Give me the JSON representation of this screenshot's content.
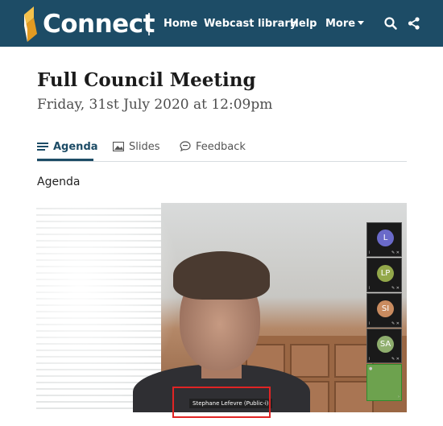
{
  "header": {
    "brand": "Connect",
    "nav": [
      "Home",
      "Webcast library",
      "Help",
      "More"
    ],
    "icons": [
      "search-icon",
      "share-icon"
    ],
    "colors": {
      "bar": "#1d4c66",
      "logo_light": "#f4c14b",
      "logo_dark": "#e29b22"
    }
  },
  "meeting": {
    "title": "Full Council Meeting",
    "date": "Friday, 31st July 2020 at 12:09pm"
  },
  "tabs": [
    {
      "label": "Agenda",
      "icon": "list-icon",
      "active": true
    },
    {
      "label": "Slides",
      "icon": "image-icon",
      "active": false
    },
    {
      "label": "Feedback",
      "icon": "chat-bubble-icon",
      "active": false
    }
  ],
  "section_title": "Agenda",
  "video": {
    "participants": [
      {
        "initials": "L",
        "color": "#6a6ac9"
      },
      {
        "initials": "LP",
        "color": "#93a84a"
      },
      {
        "initials": "SI",
        "color": "#c98b5f"
      },
      {
        "initials": "SA",
        "color": "#8fae6e"
      }
    ],
    "speaker_label": "Stephane Lefevre (Public-i)"
  }
}
